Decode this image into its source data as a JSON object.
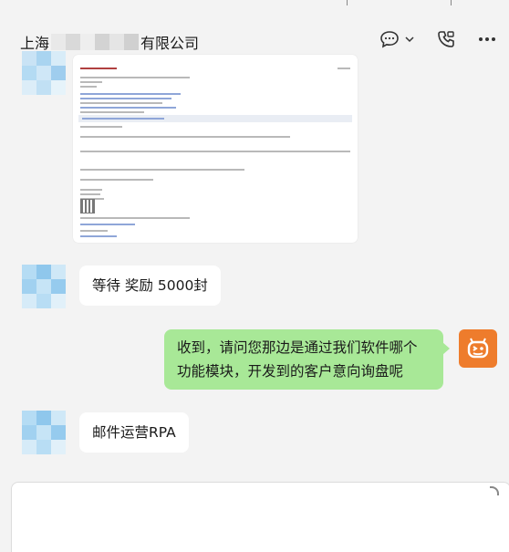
{
  "window": {
    "title_prefix": "上海",
    "title_suffix": "有限公司"
  },
  "header_icons": [
    "chat-bubble-icon",
    "chevron-down-icon",
    "phone-video-icon",
    "more-icon"
  ],
  "messages": [
    {
      "sender": "contact",
      "type": "image",
      "content": "email-screenshot"
    },
    {
      "sender": "contact",
      "type": "text",
      "text": "等待 奖励 5000封"
    },
    {
      "sender": "me",
      "type": "text",
      "lines": [
        "收到，请问您那边是通过我们软件哪个",
        "功能模块，开发到的客户意向询盘呢"
      ]
    },
    {
      "sender": "contact",
      "type": "text",
      "text": "邮件运营RPA"
    }
  ],
  "colors": {
    "my_bubble": "#a8e897",
    "contact_bubble": "#ffffff",
    "bot_avatar": "#ee7c2c",
    "background": "#f3f3f3"
  }
}
